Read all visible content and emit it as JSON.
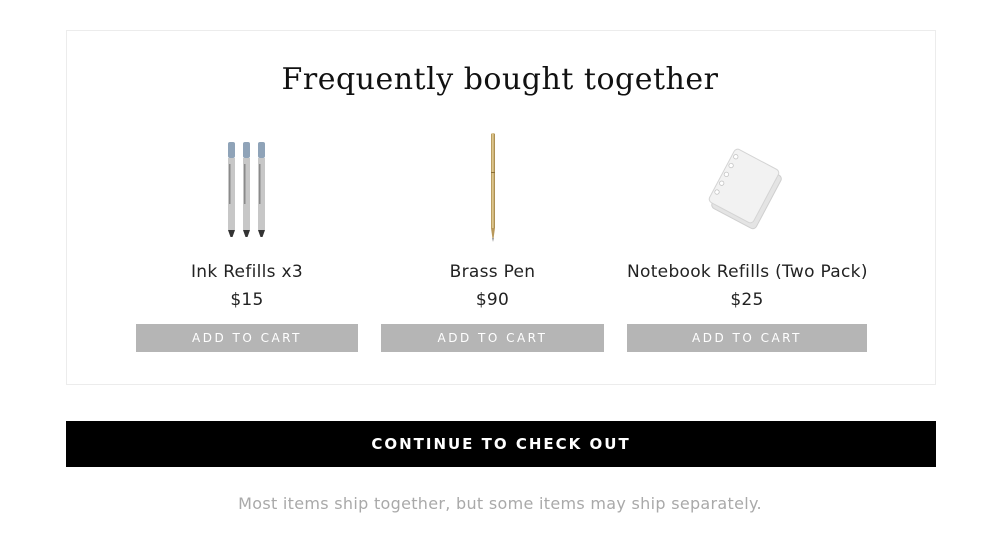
{
  "section": {
    "title": "Frequently bought together"
  },
  "products": [
    {
      "name": "Ink Refills x3",
      "price": "$15",
      "button_label": "ADD TO CART",
      "image_icon": "ink-refills-image"
    },
    {
      "name": "Brass Pen",
      "price": "$90",
      "button_label": "ADD TO CART",
      "image_icon": "brass-pen-image"
    },
    {
      "name": "Notebook Refills (Two Pack)",
      "price": "$25",
      "button_label": "ADD TO CART",
      "image_icon": "notebook-refills-image"
    }
  ],
  "checkout": {
    "label": "CONTINUE TO CHECK OUT"
  },
  "shipping_note": "Most items ship together, but some items may ship separately.",
  "colors": {
    "add_to_cart_bg": "#b5b5b5",
    "checkout_bg": "#000000",
    "note_text": "#a9a9a9"
  }
}
